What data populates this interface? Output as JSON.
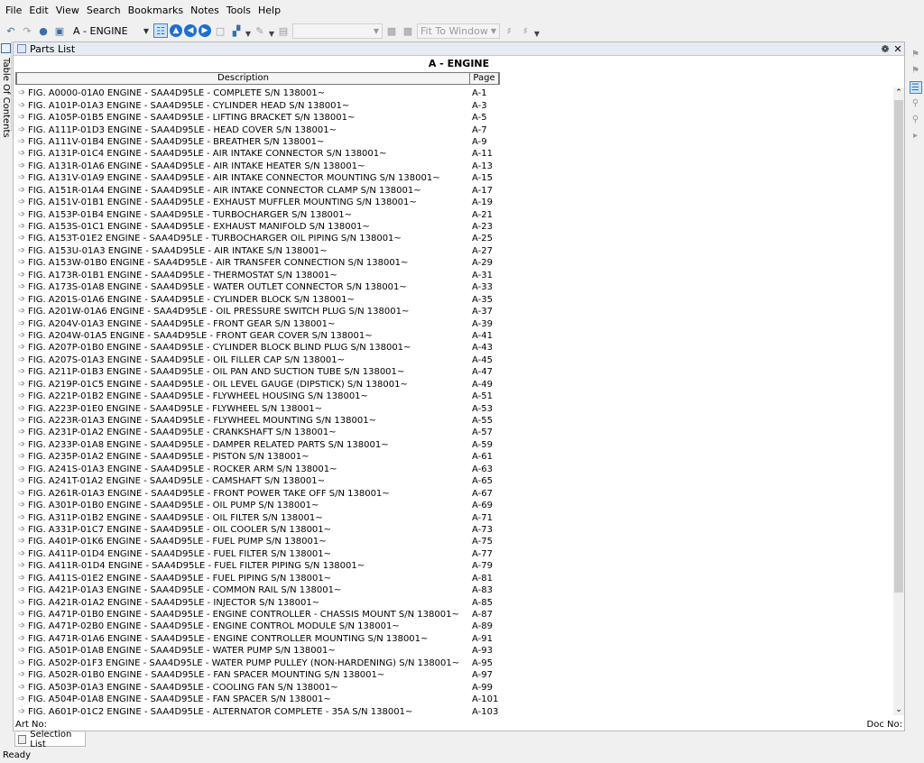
{
  "menu": [
    "File",
    "Edit",
    "View",
    "Search",
    "Bookmarks",
    "Notes",
    "Tools",
    "Help"
  ],
  "toolbar": {
    "section_value": "A - ENGINE",
    "zoom_value": "Fit To Window"
  },
  "left_tab": {
    "label": "Table Of Contents"
  },
  "panel": {
    "title": "Parts List",
    "pin": "❁",
    "close": "✕",
    "section_title": "A - ENGINE",
    "col_description": "Description",
    "col_page": "Page",
    "art_no_label": "Art No:",
    "doc_no_label": "Doc No:"
  },
  "rows": [
    [
      "FIG. A0000-01A0 ENGINE - SAA4D95LE - COMPLETE S/N 138001~",
      "A-1"
    ],
    [
      "FIG. A101P-01A3 ENGINE - SAA4D95LE - CYLINDER HEAD S/N 138001~",
      "A-3"
    ],
    [
      "FIG. A105P-01B5 ENGINE - SAA4D95LE - LIFTING BRACKET S/N 138001~",
      "A-5"
    ],
    [
      "FIG. A111P-01D3 ENGINE - SAA4D95LE - HEAD COVER S/N 138001~",
      "A-7"
    ],
    [
      "FIG. A111V-01B4 ENGINE - SAA4D95LE - BREATHER S/N 138001~",
      "A-9"
    ],
    [
      "FIG. A131P-01C4 ENGINE - SAA4D95LE - AIR INTAKE CONNECTOR S/N 138001~",
      "A-11"
    ],
    [
      "FIG. A131R-01A6 ENGINE - SAA4D95LE - AIR INTAKE HEATER S/N 138001~",
      "A-13"
    ],
    [
      "FIG. A131V-01A9 ENGINE - SAA4D95LE - AIR INTAKE CONNECTOR MOUNTING S/N 138001~",
      "A-15"
    ],
    [
      "FIG. A151R-01A4 ENGINE - SAA4D95LE - AIR INTAKE CONNECTOR CLAMP S/N 138001~",
      "A-17"
    ],
    [
      "FIG. A151V-01B1 ENGINE - SAA4D95LE - EXHAUST MUFFLER MOUNTING S/N 138001~",
      "A-19"
    ],
    [
      "FIG. A153P-01B4 ENGINE - SAA4D95LE - TURBOCHARGER S/N 138001~",
      "A-21"
    ],
    [
      "FIG. A153S-01C1 ENGINE - SAA4D95LE - EXHAUST MANIFOLD S/N 138001~",
      "A-23"
    ],
    [
      "FIG. A153T-01E2 ENGINE - SAA4D95LE - TURBOCHARGER OIL PIPING S/N 138001~",
      "A-25"
    ],
    [
      "FIG. A153U-01A3 ENGINE - SAA4D95LE - AIR INTAKE S/N 138001~",
      "A-27"
    ],
    [
      "FIG. A153W-01B0 ENGINE - SAA4D95LE - AIR TRANSFER CONNECTION S/N 138001~",
      "A-29"
    ],
    [
      "FIG. A173R-01B1 ENGINE - SAA4D95LE - THERMOSTAT S/N 138001~",
      "A-31"
    ],
    [
      "FIG. A173S-01A8 ENGINE - SAA4D95LE - WATER OUTLET CONNECTOR S/N 138001~",
      "A-33"
    ],
    [
      "FIG. A201S-01A6 ENGINE - SAA4D95LE - CYLINDER BLOCK S/N 138001~",
      "A-35"
    ],
    [
      "FIG. A201W-01A6 ENGINE - SAA4D95LE - OIL PRESSURE SWITCH PLUG S/N 138001~",
      "A-37"
    ],
    [
      "FIG. A204V-01A3 ENGINE - SAA4D95LE - FRONT GEAR S/N 138001~",
      "A-39"
    ],
    [
      "FIG. A204W-01A5 ENGINE - SAA4D95LE - FRONT GEAR COVER S/N 138001~",
      "A-41"
    ],
    [
      "FIG. A207P-01B0 ENGINE - SAA4D95LE - CYLINDER BLOCK BLIND PLUG S/N 138001~",
      "A-43"
    ],
    [
      "FIG. A207S-01A3 ENGINE - SAA4D95LE - OIL FILLER CAP S/N 138001~",
      "A-45"
    ],
    [
      "FIG. A211P-01B3 ENGINE - SAA4D95LE - OIL PAN AND SUCTION TUBE S/N 138001~",
      "A-47"
    ],
    [
      "FIG. A219P-01C5 ENGINE - SAA4D95LE - OIL LEVEL GAUGE (DIPSTICK) S/N 138001~",
      "A-49"
    ],
    [
      "FIG. A221P-01B2 ENGINE - SAA4D95LE - FLYWHEEL HOUSING S/N 138001~",
      "A-51"
    ],
    [
      "FIG. A223P-01E0 ENGINE - SAA4D95LE - FLYWHEEL S/N 138001~",
      "A-53"
    ],
    [
      "FIG. A223R-01A3 ENGINE - SAA4D95LE - FLYWHEEL MOUNTING S/N 138001~",
      "A-55"
    ],
    [
      "FIG. A231P-01A2 ENGINE - SAA4D95LE - CRANKSHAFT S/N 138001~",
      "A-57"
    ],
    [
      "FIG. A233P-01A8 ENGINE - SAA4D95LE - DAMPER RELATED PARTS S/N 138001~",
      "A-59"
    ],
    [
      "FIG. A235P-01A2 ENGINE - SAA4D95LE - PISTON S/N 138001~",
      "A-61"
    ],
    [
      "FIG. A241S-01A3 ENGINE - SAA4D95LE - ROCKER ARM S/N 138001~",
      "A-63"
    ],
    [
      "FIG. A241T-01A2 ENGINE - SAA4D95LE - CAMSHAFT S/N 138001~",
      "A-65"
    ],
    [
      "FIG. A261R-01A3 ENGINE - SAA4D95LE - FRONT POWER TAKE OFF S/N 138001~",
      "A-67"
    ],
    [
      "FIG. A301P-01B0 ENGINE - SAA4D95LE - OIL PUMP S/N 138001~",
      "A-69"
    ],
    [
      "FIG. A311P-01B2 ENGINE - SAA4D95LE - OIL FILTER S/N 138001~",
      "A-71"
    ],
    [
      "FIG. A331P-01C7 ENGINE - SAA4D95LE - OIL COOLER S/N 138001~",
      "A-73"
    ],
    [
      "FIG. A401P-01K6 ENGINE - SAA4D95LE - FUEL PUMP S/N 138001~",
      "A-75"
    ],
    [
      "FIG. A411P-01D4 ENGINE - SAA4D95LE - FUEL FILTER S/N 138001~",
      "A-77"
    ],
    [
      "FIG. A411R-01D4 ENGINE - SAA4D95LE - FUEL FILTER PIPING S/N 138001~",
      "A-79"
    ],
    [
      "FIG. A411S-01E2 ENGINE - SAA4D95LE - FUEL PIPING S/N 138001~",
      "A-81"
    ],
    [
      "FIG. A421P-01A3 ENGINE - SAA4D95LE - COMMON RAIL S/N 138001~",
      "A-83"
    ],
    [
      "FIG. A421R-01A2 ENGINE - SAA4D95LE - INJECTOR S/N 138001~",
      "A-85"
    ],
    [
      "FIG. A471P-01B0 ENGINE - SAA4D95LE - ENGINE CONTROLLER - CHASSIS MOUNT S/N 138001~",
      "A-87"
    ],
    [
      "FIG. A471P-02B0 ENGINE - SAA4D95LE - ENGINE CONTROL MODULE S/N 138001~",
      "A-89"
    ],
    [
      "FIG. A471R-01A6 ENGINE - SAA4D95LE - ENGINE CONTROLLER MOUNTING S/N 138001~",
      "A-91"
    ],
    [
      "FIG. A501P-01A8 ENGINE - SAA4D95LE - WATER PUMP S/N 138001~",
      "A-93"
    ],
    [
      "FIG. A502P-01F3 ENGINE - SAA4D95LE - WATER PUMP PULLEY (NON-HARDENING) S/N 138001~",
      "A-95"
    ],
    [
      "FIG. A502R-01B0 ENGINE - SAA4D95LE - FAN SPACER MOUNTING S/N 138001~",
      "A-97"
    ],
    [
      "FIG. A503P-01A3 ENGINE - SAA4D95LE - COOLING FAN S/N 138001~",
      "A-99"
    ],
    [
      "FIG. A504P-01A8 ENGINE - SAA4D95LE - FAN SPACER S/N 138001~",
      "A-101"
    ],
    [
      "FIG. A601P-01C2 ENGINE - SAA4D95LE - ALTERNATOR COMPLETE - 35A S/N 138001~",
      "A-103"
    ]
  ],
  "bottom_tab": {
    "label": "Selection List"
  },
  "status": {
    "text": "Ready"
  }
}
